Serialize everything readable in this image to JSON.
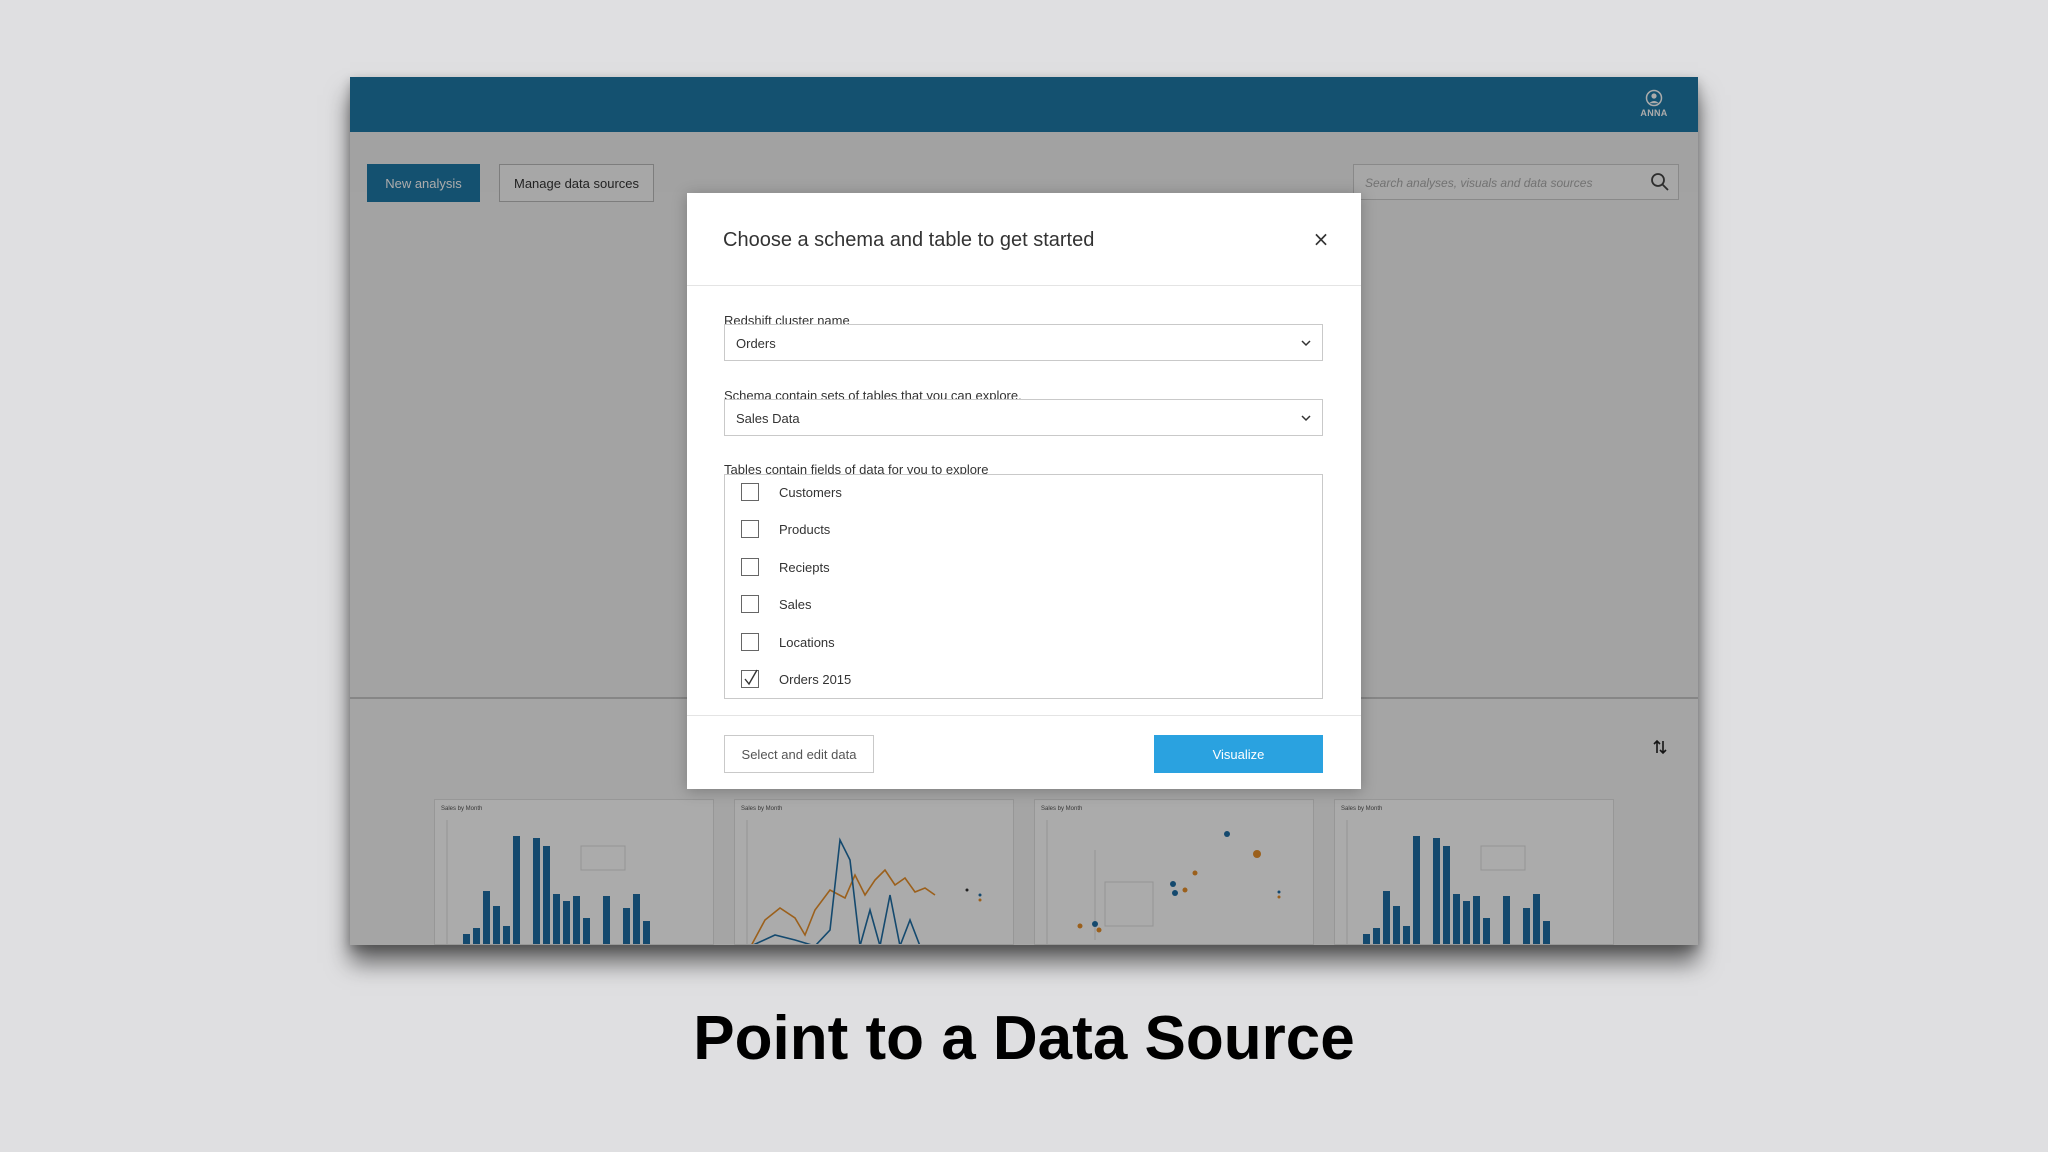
{
  "header": {
    "user_name": "ANNA"
  },
  "toolbar": {
    "new_analysis_label": "New analysis",
    "manage_data_sources_label": "Manage data sources",
    "search_placeholder": "Search analyses, visuals and data sources"
  },
  "dialog": {
    "title": "Choose a schema and table to get started",
    "cluster_label": "Redshift cluster name",
    "cluster_value": "Orders",
    "schema_label": "Schema contain sets of tables that you can explore.",
    "schema_value": "Sales Data",
    "tables_label": "Tables contain fields of data for you to explore",
    "tables": [
      {
        "label": "Customers",
        "checked": false
      },
      {
        "label": "Products",
        "checked": false
      },
      {
        "label": "Reciepts",
        "checked": false
      },
      {
        "label": "Sales",
        "checked": false
      },
      {
        "label": "Locations",
        "checked": false
      },
      {
        "label": "Orders 2015",
        "checked": true
      }
    ],
    "select_edit_label": "Select and edit data",
    "visualize_label": "Visualize"
  },
  "thumbnails": [
    {
      "title": "Sales by Month",
      "kind": "bar"
    },
    {
      "title": "Sales by Month",
      "kind": "line"
    },
    {
      "title": "Sales by Month",
      "kind": "scatter"
    },
    {
      "title": "Sales by Month",
      "kind": "bar"
    }
  ],
  "colors": {
    "brand": "#1f79a8",
    "accent": "#2aa2e0",
    "series_primary": "#1f6ea5",
    "series_secondary": "#e8902a"
  },
  "caption": "Point to a Data Source"
}
